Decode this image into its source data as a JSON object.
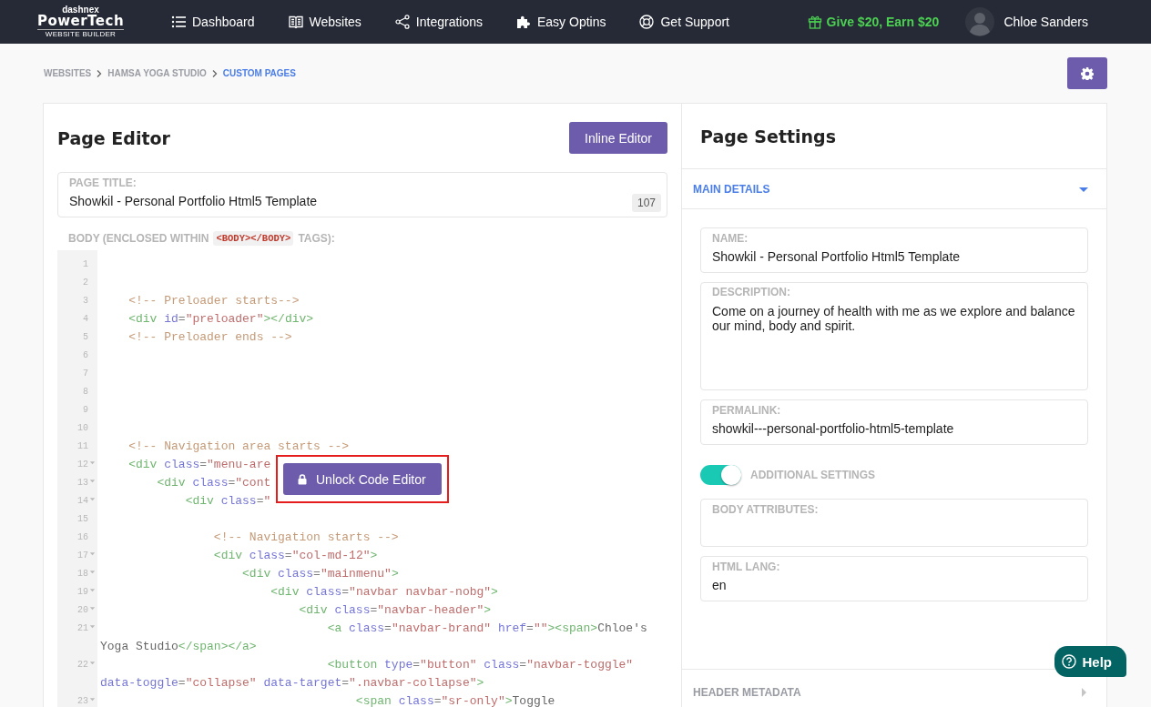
{
  "brand": {
    "small": "dashnex",
    "name": "PowerTech",
    "tagline": "WEBSITE BUILDER"
  },
  "nav": [
    {
      "label": "Dashboard",
      "kind": "list"
    },
    {
      "label": "Websites",
      "kind": "book"
    },
    {
      "label": "Integrations",
      "kind": "share"
    },
    {
      "label": "Easy Optins",
      "kind": "puzzle"
    },
    {
      "label": "Get Support",
      "kind": "lifebuoy"
    }
  ],
  "referral": "Give $20, Earn $20",
  "user": {
    "name": "Chloe Sanders"
  },
  "breadcrumbs": [
    {
      "label": "WEBSITES",
      "selected": false
    },
    {
      "label": "HAMSA YOGA STUDIO",
      "selected": false
    },
    {
      "label": "CUSTOM PAGES",
      "selected": true
    }
  ],
  "editor": {
    "title": "Page Editor",
    "inline_button": "Inline Editor",
    "page_title": {
      "label": "PAGE TITLE:",
      "value": "Showkil - Personal Portfolio Html5 Template",
      "count": "107"
    },
    "body_label": {
      "before": "BODY (ENCLOSED WITHIN",
      "code": "<BODY></BODY>",
      "after": "TAGS):"
    },
    "code_lines": [
      {
        "n": "1",
        "fold": false
      },
      {
        "n": "2",
        "fold": false
      },
      {
        "n": "3",
        "fold": false,
        "parts": [
          {
            "kind": "comment",
            "text": "    <!-- Preloader starts-->"
          }
        ]
      },
      {
        "n": "4",
        "fold": false,
        "parts": [
          {
            "kind": "tag",
            "text": "    <div"
          },
          {
            "kind": "attr",
            "text": " id"
          },
          {
            "kind": "plain",
            "text": "="
          },
          {
            "kind": "string",
            "text": "\"preloader\""
          },
          {
            "kind": "tag",
            "text": "></div>"
          }
        ]
      },
      {
        "n": "5",
        "fold": false,
        "parts": [
          {
            "kind": "comment",
            "text": "    <!-- Preloader ends -->"
          }
        ]
      },
      {
        "n": "6",
        "fold": false
      },
      {
        "n": "7",
        "fold": false
      },
      {
        "n": "8",
        "fold": false
      },
      {
        "n": "9",
        "fold": false
      },
      {
        "n": "10",
        "fold": false
      },
      {
        "n": "11",
        "fold": false,
        "parts": [
          {
            "kind": "comment",
            "text": "    <!-- Navigation area starts -->"
          }
        ]
      },
      {
        "n": "12",
        "fold": true,
        "parts": [
          {
            "kind": "tag",
            "text": "    <div"
          },
          {
            "kind": "attr",
            "text": " class"
          },
          {
            "kind": "plain",
            "text": "="
          },
          {
            "kind": "string",
            "text": "\"menu-are"
          }
        ]
      },
      {
        "n": "13",
        "fold": true,
        "parts": [
          {
            "kind": "tag",
            "text": "        <div"
          },
          {
            "kind": "attr",
            "text": " class"
          },
          {
            "kind": "plain",
            "text": "="
          },
          {
            "kind": "string",
            "text": "\"cont"
          }
        ]
      },
      {
        "n": "14",
        "fold": true,
        "parts": [
          {
            "kind": "tag",
            "text": "            <div"
          },
          {
            "kind": "attr",
            "text": " class"
          },
          {
            "kind": "plain",
            "text": "="
          },
          {
            "kind": "string",
            "text": "\""
          }
        ]
      },
      {
        "n": "15",
        "fold": false
      },
      {
        "n": "16",
        "fold": false,
        "parts": [
          {
            "kind": "comment",
            "text": "                <!-- Navigation starts -->"
          }
        ]
      },
      {
        "n": "17",
        "fold": true,
        "parts": [
          {
            "kind": "tag",
            "text": "                <div"
          },
          {
            "kind": "attr",
            "text": " class"
          },
          {
            "kind": "plain",
            "text": "="
          },
          {
            "kind": "string",
            "text": "\"col-md-12\""
          },
          {
            "kind": "tag",
            "text": ">"
          }
        ]
      },
      {
        "n": "18",
        "fold": true,
        "parts": [
          {
            "kind": "tag",
            "text": "                    <div"
          },
          {
            "kind": "attr",
            "text": " class"
          },
          {
            "kind": "plain",
            "text": "="
          },
          {
            "kind": "string",
            "text": "\"mainmenu\""
          },
          {
            "kind": "tag",
            "text": ">"
          }
        ]
      },
      {
        "n": "19",
        "fold": true,
        "parts": [
          {
            "kind": "tag",
            "text": "                        <div"
          },
          {
            "kind": "attr",
            "text": " class"
          },
          {
            "kind": "plain",
            "text": "="
          },
          {
            "kind": "string",
            "text": "\"navbar navbar-nobg\""
          },
          {
            "kind": "tag",
            "text": ">"
          }
        ]
      },
      {
        "n": "20",
        "fold": true,
        "parts": [
          {
            "kind": "tag",
            "text": "                            <div"
          },
          {
            "kind": "attr",
            "text": " class"
          },
          {
            "kind": "plain",
            "text": "="
          },
          {
            "kind": "string",
            "text": "\"navbar-header\""
          },
          {
            "kind": "tag",
            "text": ">"
          }
        ]
      },
      {
        "n": "21",
        "fold": true,
        "parts": [
          {
            "kind": "tag",
            "text": "                                <a"
          },
          {
            "kind": "attr",
            "text": " class"
          },
          {
            "kind": "plain",
            "text": "="
          },
          {
            "kind": "string",
            "text": "\"navbar-brand\""
          },
          {
            "kind": "attr",
            "text": " href"
          },
          {
            "kind": "plain",
            "text": "="
          },
          {
            "kind": "string",
            "text": "\"\""
          },
          {
            "kind": "tag",
            "text": "><span>"
          },
          {
            "kind": "text",
            "text": "Chloe's Yoga Studio"
          },
          {
            "kind": "tag",
            "text": "</span></a>"
          }
        ]
      },
      {
        "n": "22",
        "fold": true,
        "parts": [
          {
            "kind": "tag",
            "text": "                                <button"
          },
          {
            "kind": "attr",
            "text": " type"
          },
          {
            "kind": "plain",
            "text": "="
          },
          {
            "kind": "string",
            "text": "\"button\""
          },
          {
            "kind": "attr",
            "text": " class"
          },
          {
            "kind": "plain",
            "text": "="
          },
          {
            "kind": "string",
            "text": "\"navbar-toggle\""
          },
          {
            "kind": "attr",
            "text": " data-toggle"
          },
          {
            "kind": "plain",
            "text": "="
          },
          {
            "kind": "string",
            "text": "\"collapse\""
          },
          {
            "kind": "attr",
            "text": " data-target"
          },
          {
            "kind": "plain",
            "text": "="
          },
          {
            "kind": "string",
            "text": "\".navbar-collapse\""
          },
          {
            "kind": "tag",
            "text": ">"
          }
        ]
      },
      {
        "n": "23",
        "fold": true,
        "parts": [
          {
            "kind": "tag",
            "text": "                                    <span"
          },
          {
            "kind": "attr",
            "text": " class"
          },
          {
            "kind": "plain",
            "text": "="
          },
          {
            "kind": "string",
            "text": "\"sr-only\""
          },
          {
            "kind": "tag",
            "text": ">"
          },
          {
            "kind": "text",
            "text": "Toggle"
          }
        ]
      }
    ],
    "unlock_button": "Unlock Code Editor"
  },
  "settings": {
    "title": "Page Settings",
    "main_section": {
      "label": "MAIN DETAILS",
      "expanded": true
    },
    "fields": [
      {
        "label": "NAME:",
        "value": "Showkil - Personal Portfolio Html5 Template",
        "kind": "input"
      },
      {
        "label": "DESCRIPTION:",
        "value": "Come on a journey of health with me as we explore and balance our mind, body and spirit.",
        "kind": "textarea"
      },
      {
        "label": "PERMALINK:",
        "value": "showkil---personal-portfolio-html5-template",
        "kind": "input"
      }
    ],
    "additional": {
      "label": "ADDITIONAL SETTINGS",
      "on": true
    },
    "extra_fields": [
      {
        "label": "BODY ATTRIBUTES:",
        "kind": "input"
      },
      {
        "label": "HTML LANG:",
        "value": "en",
        "kind": "input"
      }
    ],
    "header_section": {
      "label": "HEADER METADATA",
      "expanded": false
    }
  },
  "help": "Help"
}
